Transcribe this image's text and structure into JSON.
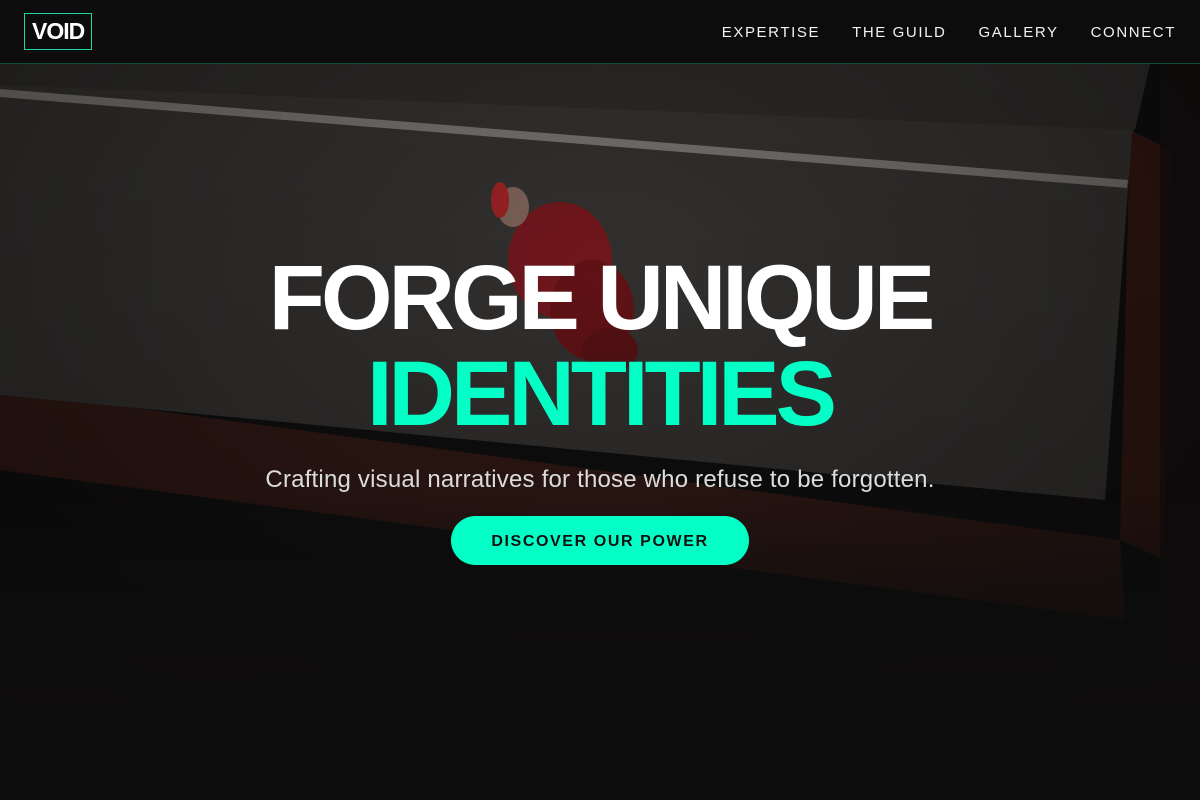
{
  "brand": {
    "logo_text": "VOID"
  },
  "nav": {
    "items": [
      {
        "label": "EXPERTISE"
      },
      {
        "label": "THE GUILD"
      },
      {
        "label": "GALLERY"
      },
      {
        "label": "CONNECT"
      }
    ]
  },
  "hero": {
    "headline_line1": "FORGE UNIQUE",
    "headline_line2": "IDENTITIES",
    "subtitle": "Crafting visual narratives for those who refuse to be forgotten.",
    "cta_label": "DISCOVER OUR POWER"
  },
  "colors": {
    "accent": "#03ffc6",
    "background": "#0e0d0d",
    "text": "#ffffff"
  }
}
